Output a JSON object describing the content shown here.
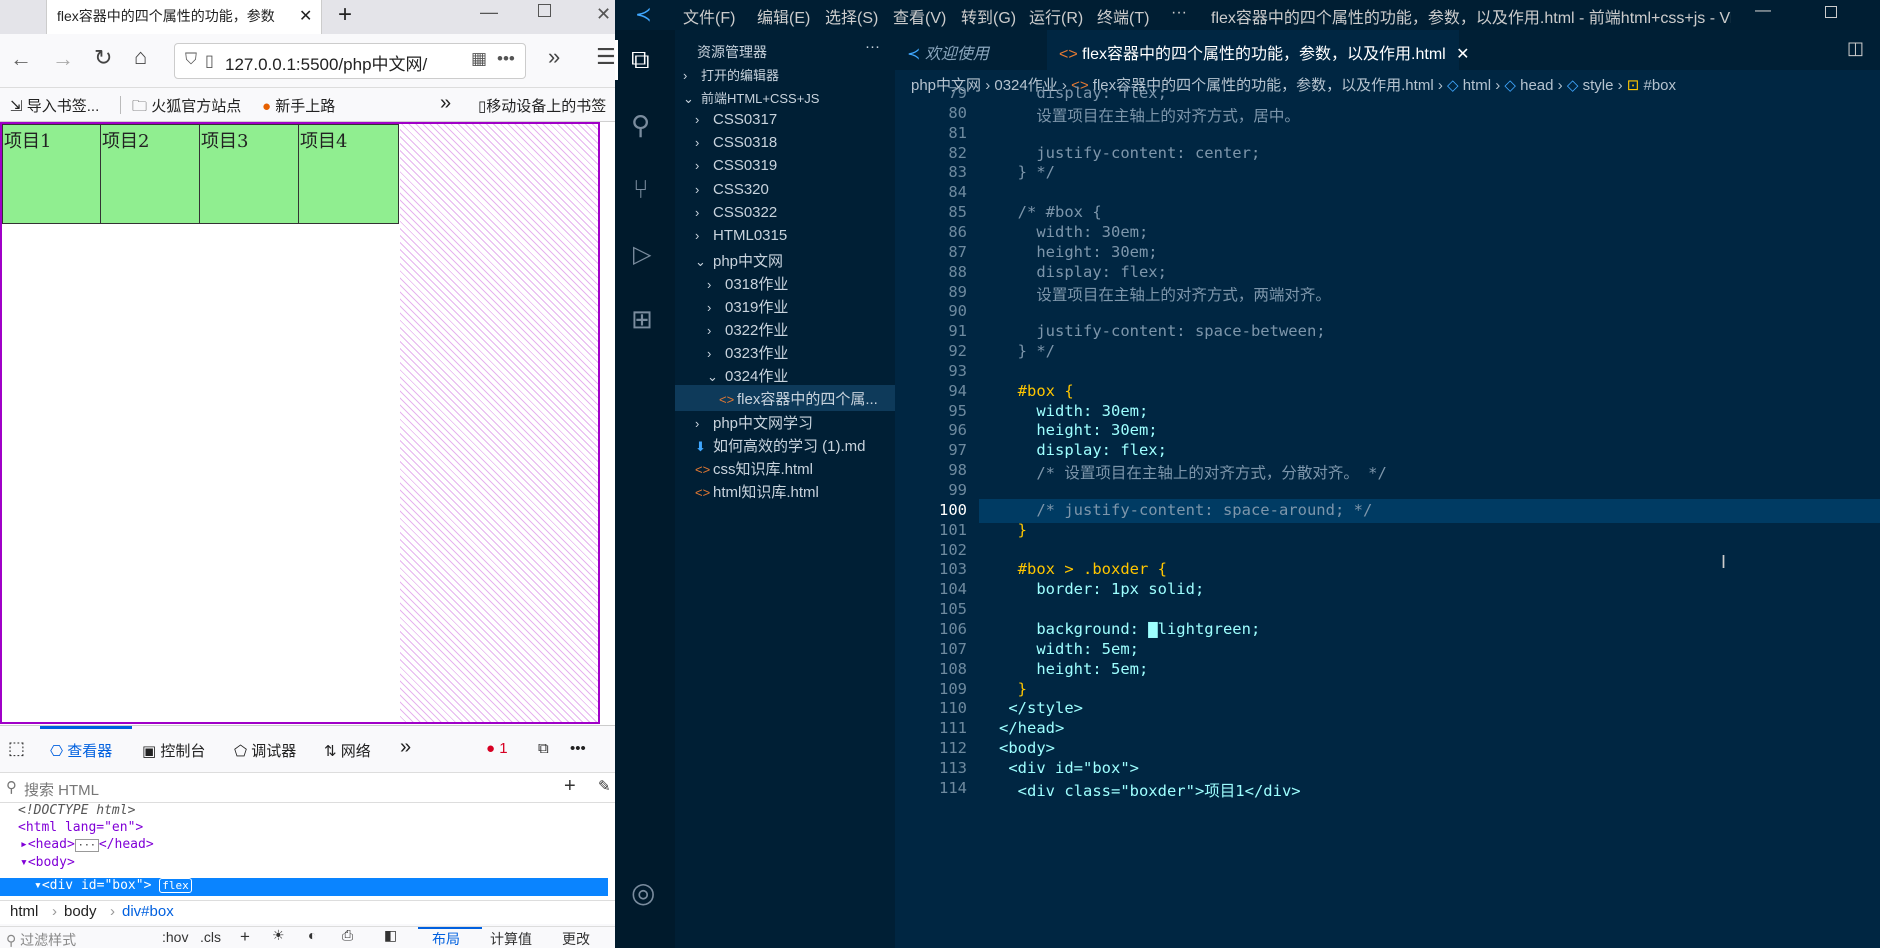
{
  "browser": {
    "tab_title": "flex容器中的四个属性的功能，参数",
    "url": "127.0.0.1:5500/php中文网/",
    "bookmarks": [
      "导入书签...",
      "火狐官方站点",
      "新手上路",
      "移动设备上的书签"
    ],
    "items": [
      "项目1",
      "项目2",
      "项目3",
      "项目4"
    ],
    "devtools_tabs": [
      "查看器",
      "控制台",
      "调试器",
      "网络"
    ],
    "error_count": "1",
    "search_placeholder": "搜索 HTML",
    "tree": [
      "<!DOCTYPE html>",
      "<html lang=\"en\">",
      "<head>",
      "</head>",
      "<body>",
      "<div id=\"box\">",
      "flex"
    ],
    "crumbs": [
      "html",
      "body",
      "div#box"
    ],
    "rules": [
      "过滤样式",
      ":hov",
      ".cls",
      "布局",
      "计算值",
      "更改"
    ]
  },
  "vscode": {
    "menus": [
      "文件(F)",
      "编辑(E)",
      "选择(S)",
      "查看(V)",
      "转到(G)",
      "运行(R)",
      "终端(T)",
      "···"
    ],
    "title": "flex容器中的四个属性的功能，参数，以及作用.html - 前端html+css+js - Visual ...",
    "explorer_title": "资源管理器",
    "sidebar": [
      {
        "label": "打开的编辑器",
        "indent": 0,
        "arrow": "›",
        "bold": true
      },
      {
        "label": "前端HTML+CSS+JS",
        "indent": 0,
        "arrow": "⌄",
        "bold": true
      },
      {
        "label": "CSS0317",
        "indent": 1,
        "arrow": "›"
      },
      {
        "label": "CSS0318",
        "indent": 1,
        "arrow": "›"
      },
      {
        "label": "CSS0319",
        "indent": 1,
        "arrow": "›"
      },
      {
        "label": "CSS320",
        "indent": 1,
        "arrow": "›"
      },
      {
        "label": "CSS0322",
        "indent": 1,
        "arrow": "›"
      },
      {
        "label": "HTML0315",
        "indent": 1,
        "arrow": "›"
      },
      {
        "label": "php中文网",
        "indent": 1,
        "arrow": "⌄"
      },
      {
        "label": "0318作业",
        "indent": 2,
        "arrow": "›"
      },
      {
        "label": "0319作业",
        "indent": 2,
        "arrow": "›"
      },
      {
        "label": "0322作业",
        "indent": 2,
        "arrow": "›"
      },
      {
        "label": "0323作业",
        "indent": 2,
        "arrow": "›"
      },
      {
        "label": "0324作业",
        "indent": 2,
        "arrow": "⌄"
      },
      {
        "label": "flex容器中的四个属...",
        "indent": 3,
        "arrow": "<>",
        "active": true
      },
      {
        "label": "php中文网学习",
        "indent": 1,
        "arrow": "›"
      },
      {
        "label": "如何高效的学习 (1).md",
        "indent": 1,
        "arrow": "⬇"
      },
      {
        "label": "css知识库.html",
        "indent": 1,
        "arrow": "<>"
      },
      {
        "label": "html知识库.html",
        "indent": 1,
        "arrow": "<>"
      }
    ],
    "tabs": [
      "欢迎使用",
      "flex容器中的四个属性的功能，参数，以及作用.html"
    ],
    "breadcrumb": [
      "php中文网",
      "0324作业",
      "flex容器中的四个属性的功能，参数，以及作用.html",
      "html",
      "head",
      "style",
      "#box"
    ],
    "code": [
      {
        "n": "79",
        "t": "    display: flex;",
        "c": "cmt"
      },
      {
        "n": "80",
        "t": "    设置项目在主轴上的对齐方式，居中。",
        "c": "cmt"
      },
      {
        "n": "81",
        "t": "",
        "c": "cmt"
      },
      {
        "n": "82",
        "t": "    justify-content: center;",
        "c": "cmt"
      },
      {
        "n": "83",
        "t": "  } */",
        "c": "cmt"
      },
      {
        "n": "84",
        "t": "",
        "c": "cmt"
      },
      {
        "n": "85",
        "t": "  /* #box {",
        "c": "cmt"
      },
      {
        "n": "86",
        "t": "    width: 30em;",
        "c": "cmt"
      },
      {
        "n": "87",
        "t": "    height: 30em;",
        "c": "cmt"
      },
      {
        "n": "88",
        "t": "    display: flex;",
        "c": "cmt"
      },
      {
        "n": "89",
        "t": "    设置项目在主轴上的对齐方式，两端对齐。",
        "c": "cmt"
      },
      {
        "n": "90",
        "t": "",
        "c": "cmt"
      },
      {
        "n": "91",
        "t": "    justify-content: space-between;",
        "c": "cmt"
      },
      {
        "n": "92",
        "t": "  } */",
        "c": "cmt"
      },
      {
        "n": "93",
        "t": "",
        "c": "pun"
      },
      {
        "n": "94",
        "t": "  #box {",
        "c": "sel2"
      },
      {
        "n": "95",
        "t": "    width: 30em;",
        "c": "decl"
      },
      {
        "n": "96",
        "t": "    height: 30em;",
        "c": "decl"
      },
      {
        "n": "97",
        "t": "    display: flex;",
        "c": "decl"
      },
      {
        "n": "98",
        "t": "    /* 设置项目在主轴上的对齐方式，分散对齐。 */",
        "c": "cmt"
      },
      {
        "n": "99",
        "t": "",
        "c": "pun"
      },
      {
        "n": "100",
        "t": "    /* justify-content: space-around; */",
        "c": "cmt"
      },
      {
        "n": "101",
        "t": "  }",
        "c": "sel2"
      },
      {
        "n": "102",
        "t": "",
        "c": "pun"
      },
      {
        "n": "103",
        "t": "  #box > .boxder {",
        "c": "sel2"
      },
      {
        "n": "104",
        "t": "    border: 1px solid;",
        "c": "decl"
      },
      {
        "n": "105",
        "t": "",
        "c": "pun"
      },
      {
        "n": "106",
        "t": "    background: ▇lightgreen;",
        "c": "decl"
      },
      {
        "n": "107",
        "t": "    width: 5em;",
        "c": "decl"
      },
      {
        "n": "108",
        "t": "    height: 5em;",
        "c": "decl"
      },
      {
        "n": "109",
        "t": "  }",
        "c": "sel2"
      },
      {
        "n": "110",
        "t": " </style>",
        "c": "tag"
      },
      {
        "n": "111",
        "t": "</head>",
        "c": "tag"
      },
      {
        "n": "112",
        "t": "<body>",
        "c": "tag"
      },
      {
        "n": "113",
        "t": " <div id=\"box\">",
        "c": "tag"
      },
      {
        "n": "114",
        "t": "  <div class=\"boxder\">项目1</div>",
        "c": "tag"
      }
    ]
  }
}
